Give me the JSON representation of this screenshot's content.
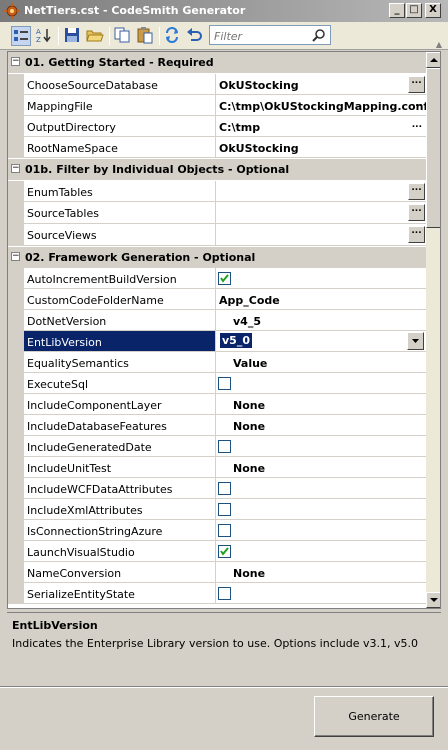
{
  "window": {
    "title": "NetTiers.cst - CodeSmith Generator",
    "min_glyph": "_",
    "max_glyph": "□",
    "close_glyph": "X"
  },
  "toolbar": {
    "filter_placeholder": "Filter",
    "buttons": [
      "categorized-icon",
      "alphabetical-icon",
      "save-icon",
      "open-folder-icon",
      "copy-icon",
      "paste-icon",
      "refresh-icon",
      "undo-icon"
    ]
  },
  "grid": {
    "categories": [
      {
        "label": "01. Getting Started - Required",
        "expander": "−"
      },
      {
        "label": "01b. Filter by Individual Objects - Optional",
        "expander": "−"
      },
      {
        "label": "02. Framework Generation - Optional",
        "expander": "−"
      }
    ],
    "ellipsis": "...",
    "props": {
      "choose_source_database": {
        "name": "ChooseSourceDatabase",
        "value": "OkUStocking"
      },
      "mapping_file": {
        "name": "MappingFile",
        "value": "C:\\tmp\\OkUStockingMapping.conf"
      },
      "output_directory": {
        "name": "OutputDirectory",
        "value": "C:\\tmp"
      },
      "root_namespace": {
        "name": "RootNameSpace",
        "value": "OkUStocking"
      },
      "enum_tables": {
        "name": "EnumTables",
        "value": ""
      },
      "source_tables": {
        "name": "SourceTables",
        "value": ""
      },
      "source_views": {
        "name": "SourceViews",
        "value": ""
      },
      "auto_increment": {
        "name": "AutoIncrementBuildVersion",
        "checked": true
      },
      "custom_code_folder": {
        "name": "CustomCodeFolderName",
        "value": "App_Code"
      },
      "dotnet_version": {
        "name": "DotNetVersion",
        "value": "v4_5"
      },
      "entlib_version": {
        "name": "EntLibVersion",
        "value": "v5_0"
      },
      "equality_semantics": {
        "name": "EqualitySemantics",
        "value": "Value"
      },
      "execute_sql": {
        "name": "ExecuteSql",
        "checked": false
      },
      "include_component_layer": {
        "name": "IncludeComponentLayer",
        "value": "None"
      },
      "include_database_features": {
        "name": "IncludeDatabaseFeatures",
        "value": "None"
      },
      "include_generated_date": {
        "name": "IncludeGeneratedDate",
        "checked": false
      },
      "include_unit_test": {
        "name": "IncludeUnitTest",
        "value": "None"
      },
      "include_wcf": {
        "name": "IncludeWCFDataAttributes",
        "checked": false
      },
      "include_xml": {
        "name": "IncludeXmlAttributes",
        "checked": false
      },
      "is_azure": {
        "name": "IsConnectionStringAzure",
        "checked": false
      },
      "launch_vs": {
        "name": "LaunchVisualStudio",
        "checked": true
      },
      "name_conversion": {
        "name": "NameConversion",
        "value": "None"
      },
      "serialize_entity_state": {
        "name": "SerializeEntityState",
        "checked": false
      }
    }
  },
  "help": {
    "title": "EntLibVersion",
    "description": "Indicates the Enterprise Library version to use. Options include v3.1, v5.0"
  },
  "actions": {
    "generate_label": "Generate"
  },
  "colors": {
    "selection": "#0a246a",
    "chrome": "#d4d0c8",
    "title_gradient_start": "#7a7a7a"
  }
}
